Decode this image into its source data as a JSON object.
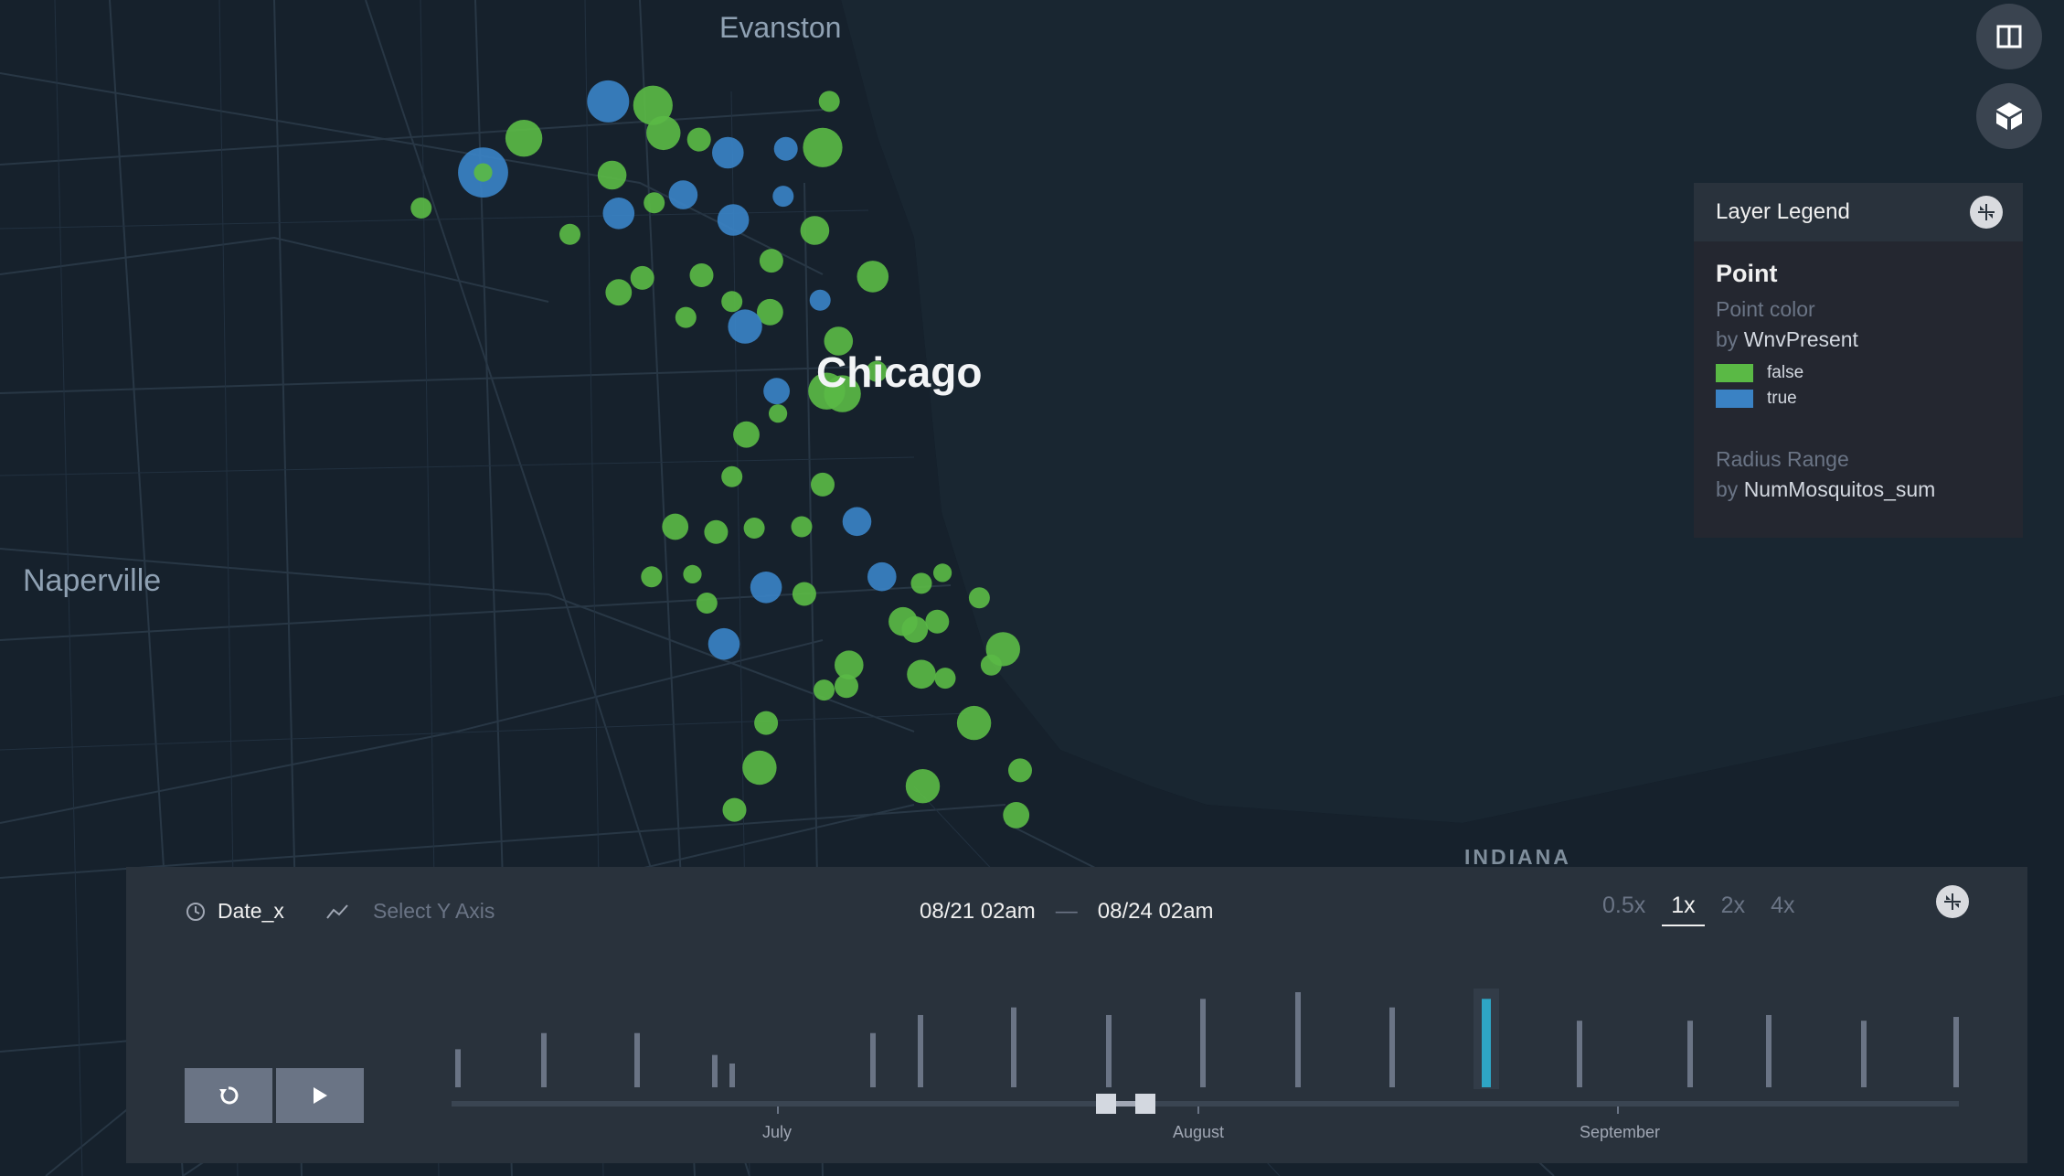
{
  "map": {
    "labels": {
      "evanston": "Evanston",
      "chicago": "Chicago",
      "naperville": "Naperville",
      "indiana": "INDIANA"
    },
    "points": [
      [
        462,
        77,
        16,
        "t"
      ],
      [
        496,
        80,
        15,
        "f"
      ],
      [
        504,
        101,
        13,
        "f"
      ],
      [
        398,
        105,
        14,
        "f"
      ],
      [
        531,
        106,
        9,
        "f"
      ],
      [
        553,
        116,
        12,
        "t"
      ],
      [
        597,
        113,
        9,
        "t"
      ],
      [
        625,
        112,
        15,
        "f"
      ],
      [
        630,
        77,
        8,
        "f"
      ],
      [
        367,
        131,
        19,
        "t"
      ],
      [
        367,
        131,
        7,
        "f"
      ],
      [
        465,
        133,
        11,
        "f"
      ],
      [
        519,
        148,
        11,
        "t"
      ],
      [
        497,
        154,
        8,
        "f"
      ],
      [
        470,
        162,
        12,
        "t"
      ],
      [
        557,
        167,
        12,
        "t"
      ],
      [
        595,
        149,
        8,
        "t"
      ],
      [
        320,
        158,
        8,
        "f"
      ],
      [
        433,
        178,
        8,
        "f"
      ],
      [
        619,
        175,
        11,
        "f"
      ],
      [
        586,
        198,
        9,
        "f"
      ],
      [
        663,
        210,
        12,
        "f"
      ],
      [
        488,
        211,
        9,
        "f"
      ],
      [
        533,
        209,
        9,
        "f"
      ],
      [
        470,
        222,
        10,
        "f"
      ],
      [
        556,
        229,
        8,
        "f"
      ],
      [
        623,
        228,
        8,
        "t"
      ],
      [
        585,
        237,
        10,
        "f"
      ],
      [
        521,
        241,
        8,
        "f"
      ],
      [
        566,
        248,
        13,
        "t"
      ],
      [
        637,
        259,
        11,
        "f"
      ],
      [
        590,
        297,
        10,
        "t"
      ],
      [
        628,
        297,
        14,
        "f"
      ],
      [
        640,
        299,
        14,
        "f"
      ],
      [
        666,
        282,
        8,
        "f"
      ],
      [
        591,
        314,
        7,
        "f"
      ],
      [
        567,
        330,
        10,
        "f"
      ],
      [
        556,
        362,
        8,
        "f"
      ],
      [
        625,
        368,
        9,
        "f"
      ],
      [
        513,
        400,
        10,
        "f"
      ],
      [
        544,
        404,
        9,
        "f"
      ],
      [
        573,
        401,
        8,
        "f"
      ],
      [
        609,
        400,
        8,
        "f"
      ],
      [
        651,
        396,
        11,
        "t"
      ],
      [
        495,
        438,
        8,
        "f"
      ],
      [
        526,
        436,
        7,
        "f"
      ],
      [
        582,
        446,
        12,
        "t"
      ],
      [
        611,
        451,
        9,
        "f"
      ],
      [
        670,
        438,
        11,
        "t"
      ],
      [
        700,
        443,
        8,
        "f"
      ],
      [
        716,
        435,
        7,
        "f"
      ],
      [
        744,
        454,
        8,
        "f"
      ],
      [
        537,
        458,
        8,
        "f"
      ],
      [
        686,
        472,
        11,
        "f"
      ],
      [
        695,
        478,
        10,
        "f"
      ],
      [
        712,
        472,
        9,
        "f"
      ],
      [
        762,
        493,
        13,
        "f"
      ],
      [
        753,
        505,
        8,
        "f"
      ],
      [
        550,
        489,
        12,
        "t"
      ],
      [
        645,
        505,
        11,
        "f"
      ],
      [
        643,
        521,
        9,
        "f"
      ],
      [
        626,
        524,
        8,
        "f"
      ],
      [
        700,
        512,
        11,
        "f"
      ],
      [
        718,
        515,
        8,
        "f"
      ],
      [
        740,
        549,
        13,
        "f"
      ],
      [
        582,
        549,
        9,
        "f"
      ],
      [
        577,
        583,
        13,
        "f"
      ],
      [
        775,
        585,
        9,
        "f"
      ],
      [
        701,
        597,
        13,
        "f"
      ],
      [
        558,
        615,
        9,
        "f"
      ],
      [
        772,
        619,
        10,
        "f"
      ]
    ]
  },
  "controls": {
    "split_icon": "split-map-icon",
    "view3d_icon": "3d-map-icon"
  },
  "legend": {
    "title": "Layer Legend",
    "layer_name": "Point",
    "color_label": "Point color",
    "color_by_prefix": "by",
    "color_field": "WnvPresent",
    "items": [
      {
        "label": "false",
        "color": "#5ab945"
      },
      {
        "label": "true",
        "color": "#3a82c4"
      }
    ],
    "radius_label": "Radius Range",
    "radius_by_prefix": "by",
    "radius_field": "NumMosquitos_sum"
  },
  "timeline": {
    "field": "Date_x",
    "y_axis_placeholder": "Select Y Axis",
    "range_start": "08/21 02am",
    "range_sep": "—",
    "range_end": "08/24 02am",
    "speeds": [
      "0.5x",
      "1x",
      "2x",
      "4x"
    ],
    "active_speed": "1x",
    "axis_labels": [
      "July",
      "August",
      "September"
    ],
    "histogram_counts": [
      0.4,
      0.57,
      0.57,
      0.34,
      0.25,
      0.57,
      0.76,
      0.84,
      0.76,
      0.93,
      1.0,
      0.84,
      0.93,
      0.7,
      0.7,
      0.76,
      0.7,
      0.74,
      0.52
    ],
    "selected_index": 12,
    "accent": "#2ea5c5"
  }
}
